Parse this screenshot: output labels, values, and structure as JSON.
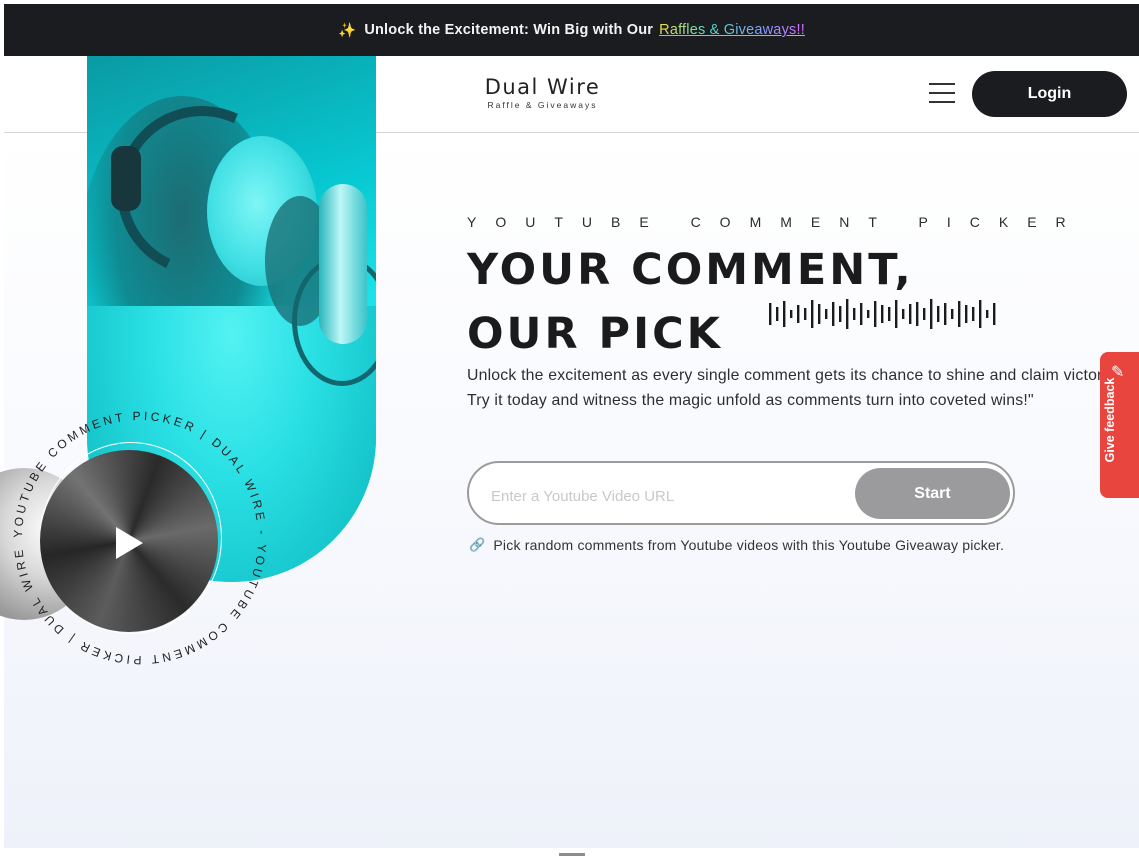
{
  "announcement": {
    "icon": "sparkles-icon",
    "text": "Unlock the Excitement: Win Big with Our",
    "link": "Raffles & Giveaways!!"
  },
  "header": {
    "logo_main": "Dual Wire",
    "logo_sub": "Raffle & Giveaways",
    "menu_icon": "hamburger-menu-icon",
    "login_label": "Login"
  },
  "disc": {
    "circular_text": "YOUTUBE COMMENT PICKER | DUAL WIRE - YOUTUBE COMMENT PICKER | DUAL WIRE - ",
    "play_icon": "play-icon"
  },
  "hero": {
    "eyebrow": "YOUTUBE COMMENT PICKER",
    "headline_line1": "YOUR COMMENT,",
    "headline_line2": "OUR PICK",
    "description": "Unlock the excitement as every single comment gets its chance to shine and claim victory, Try it today and witness the magic unfold as comments turn into coveted wins!\"",
    "input_placeholder": "Enter a Youtube Video URL",
    "input_value": "",
    "start_label": "Start",
    "hint_icon": "link-icon",
    "hint_text": "Pick random comments from Youtube videos with this Youtube Giveaway picker."
  },
  "feedback": {
    "label": "Give feedback",
    "icon": "pencil-icon",
    "color": "#e8453f"
  },
  "colors": {
    "dark": "#1b1c1f",
    "photo_tint": "#08c9d2",
    "start_button": "#9b9b9d"
  }
}
